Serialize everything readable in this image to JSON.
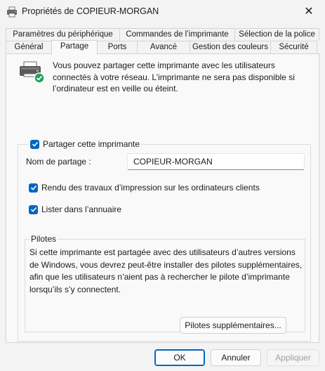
{
  "window": {
    "title": "Propriétés de COPIEUR-MORGAN",
    "close_glyph": "✕"
  },
  "tabs_top": [
    {
      "label": "Paramètres du périphérique"
    },
    {
      "label": "Commandes de l’imprimante"
    },
    {
      "label": "Sélection de la police"
    }
  ],
  "tabs_bottom": [
    {
      "label": "Général"
    },
    {
      "label": "Partage",
      "active": true
    },
    {
      "label": "Ports"
    },
    {
      "label": "Avancé"
    },
    {
      "label": "Gestion des couleurs"
    },
    {
      "label": "Sécurité"
    }
  ],
  "intro_text": "Vous pouvez partager cette imprimante avec les utilisateurs connectés à votre réseau. L’imprimante ne sera pas disponible si l’ordinateur est en veille ou éteint.",
  "share": {
    "checkbox_label": "Partager cette imprimante",
    "checked": true,
    "share_name_label": "Nom de partage :",
    "share_name_value": "COPIEUR-MORGAN",
    "render_label": "Rendu des travaux d’impression sur les ordinateurs clients",
    "render_checked": true,
    "list_label": "Lister dans l’annuaire",
    "list_checked": true
  },
  "drivers": {
    "heading": "Pilotes",
    "text": "Si cette imprimante est partagée avec des utilisateurs d’autres versions de Windows, vous devrez peut-être installer des pilotes supplémentaires, afin que les utilisateurs n’aient pas à rechercher le pilote d’imprimante lorsqu’ils s’y connectent.",
    "button": "Pilotes supplémentaires..."
  },
  "footer": {
    "ok": "OK",
    "cancel": "Annuler",
    "apply": "Appliquer"
  },
  "colors": {
    "accent": "#0067c0",
    "status_ok": "#1fa05a"
  },
  "icons": {
    "title": "printer-icon",
    "main": "network-printer-icon",
    "checkbox": "checkmark-icon"
  }
}
